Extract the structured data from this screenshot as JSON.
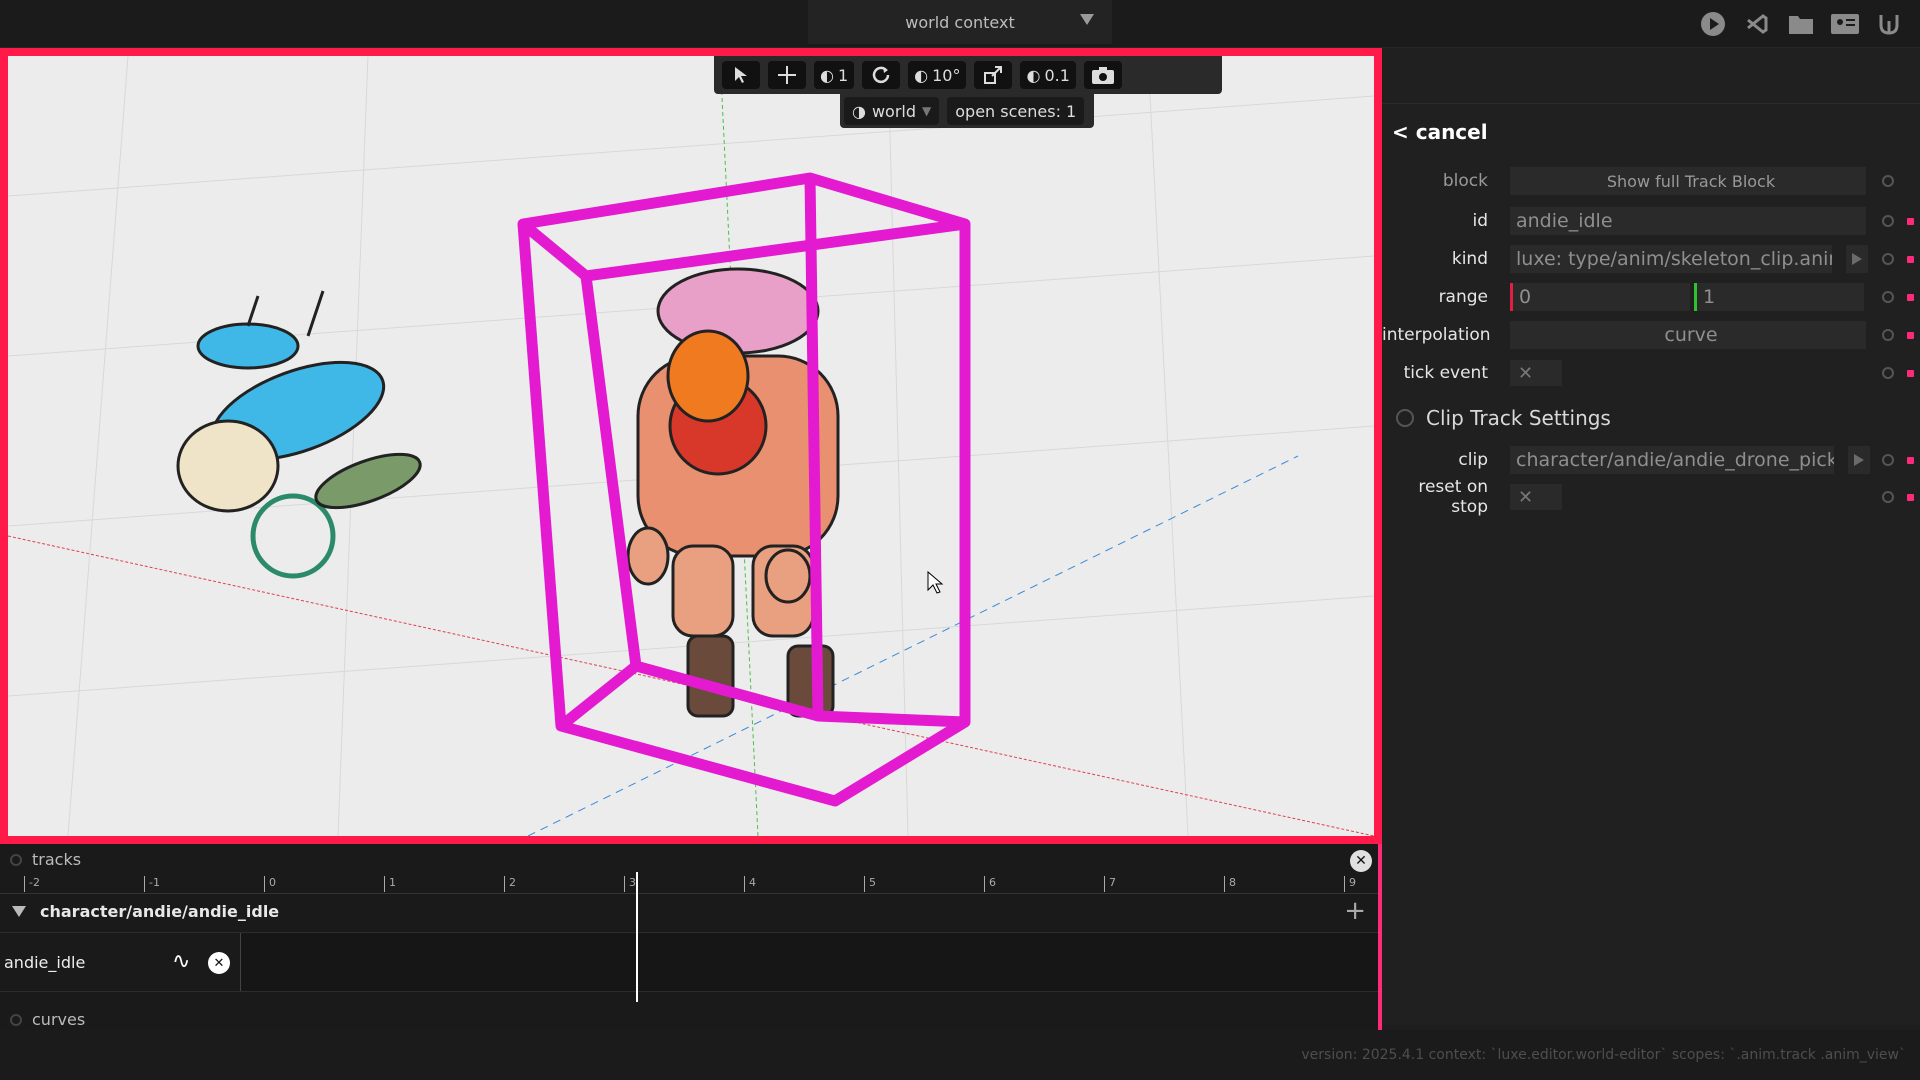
{
  "topbar": {
    "context_label": "world context",
    "icons": [
      "play-icon",
      "vscode-icon",
      "folder-icon",
      "id-card-icon",
      "tool-icon"
    ]
  },
  "viewport": {
    "border_color": "#ff1a4a",
    "toolbar": {
      "snap_move": "1",
      "snap_rotate": "10°",
      "snap_scale": "0.1"
    },
    "sub": {
      "world_label": "world",
      "open_scenes": "open scenes: 1"
    }
  },
  "inspector": {
    "cancel": "< cancel",
    "block_label": "block",
    "block_button": "Show full Track Block",
    "id_label": "id",
    "id_value": "andie_idle",
    "kind_label": "kind",
    "kind_value": "luxe: type/anim/skeleton_clip.anim",
    "range_label": "range",
    "range_start": "0",
    "range_end": "1",
    "interp_label": "interpolation",
    "interp_value": "curve",
    "tick_label": "tick event",
    "tick_value": "✕",
    "section_title": "Clip Track Settings",
    "clip_label": "clip",
    "clip_value": "character/andie/andie_drone_pick",
    "reset_label": "reset on stop",
    "reset_value": "✕"
  },
  "tracks": {
    "title": "tracks",
    "ruler": [
      "-2",
      "-1",
      "0",
      "1",
      "2",
      "3",
      "4",
      "5",
      "6",
      "7",
      "8",
      "9"
    ],
    "group": "character/andie/andie_idle",
    "track_name": "andie_idle",
    "curves_title": "curves",
    "playhead_time": 3.1
  },
  "status": "version: 2025.4.1 context: `luxe.editor.world-editor` scopes: `.anim.track .anim_view`"
}
